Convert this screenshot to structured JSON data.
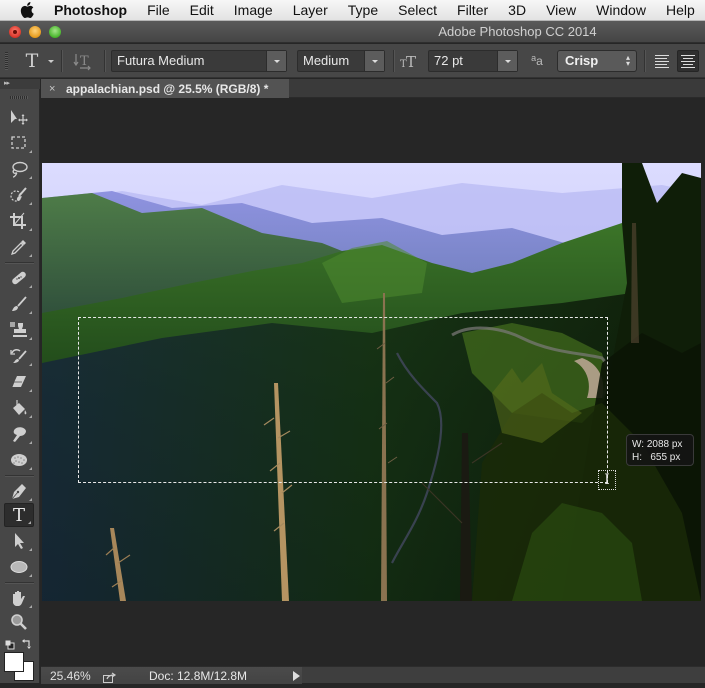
{
  "menubar": {
    "apple_icon": "apple-logo-icon",
    "items": [
      "Photoshop",
      "File",
      "Edit",
      "Image",
      "Layer",
      "Type",
      "Select",
      "Filter",
      "3D",
      "View",
      "Window",
      "Help"
    ]
  },
  "window": {
    "title": "Adobe Photoshop CC 2014",
    "controls": [
      "close",
      "minimize",
      "zoom"
    ]
  },
  "options_bar": {
    "tool_preset_icon": "horizontal-type-icon",
    "orientation_icon": "toggle-text-orientation-icon",
    "font_family": "Futura Medium",
    "font_style": "Medium",
    "font_size_icon": "font-size-icon",
    "font_size": "72 pt",
    "antialias_icon": "anti-alias-icon",
    "antialias": "Crisp",
    "align": {
      "options": [
        "left",
        "center"
      ],
      "selected": "center"
    }
  },
  "document_tab": {
    "close_label": "×",
    "title": "appalachian.psd @ 25.5% (RGB/8) *"
  },
  "tools": [
    {
      "name": "move-tool",
      "icon": "move-icon"
    },
    {
      "name": "rectangular-marquee-tool",
      "icon": "marquee-icon"
    },
    {
      "name": "lasso-tool",
      "icon": "lasso-icon"
    },
    {
      "name": "quick-selection-tool",
      "icon": "quick-selection-icon"
    },
    {
      "name": "crop-tool",
      "icon": "crop-icon"
    },
    {
      "name": "eyedropper-tool",
      "icon": "eyedropper-icon"
    },
    {
      "name": "spot-healing-tool",
      "icon": "bandage-icon"
    },
    {
      "name": "brush-tool",
      "icon": "brush-icon"
    },
    {
      "name": "clone-stamp-tool",
      "icon": "stamp-icon"
    },
    {
      "name": "history-brush-tool",
      "icon": "history-brush-icon"
    },
    {
      "name": "eraser-tool",
      "icon": "eraser-icon"
    },
    {
      "name": "paint-bucket-tool",
      "icon": "paint-bucket-icon"
    },
    {
      "name": "smudge-tool",
      "icon": "smudge-icon"
    },
    {
      "name": "sponge-tool",
      "icon": "sponge-icon"
    },
    {
      "name": "pen-tool",
      "icon": "pen-icon"
    },
    {
      "name": "type-tool",
      "icon": "type-icon",
      "active": true
    },
    {
      "name": "path-selection-tool",
      "icon": "arrow-icon"
    },
    {
      "name": "ellipse-tool",
      "icon": "ellipse-icon"
    },
    {
      "name": "hand-tool",
      "icon": "hand-icon"
    },
    {
      "name": "zoom-tool",
      "icon": "magnifier-icon"
    }
  ],
  "colors": {
    "foreground": "#ffffff",
    "background": "#ffffff"
  },
  "canvas": {
    "image_subject": "Appalachian mountain landscape at dusk",
    "selection_tooltip": {
      "width_label": "W:",
      "width_value": "2088 px",
      "height_label": "H:",
      "height_value": "655 px"
    }
  },
  "status_bar": {
    "zoom": "25.46%",
    "doc_size": "Doc: 12.8M/12.8M"
  }
}
